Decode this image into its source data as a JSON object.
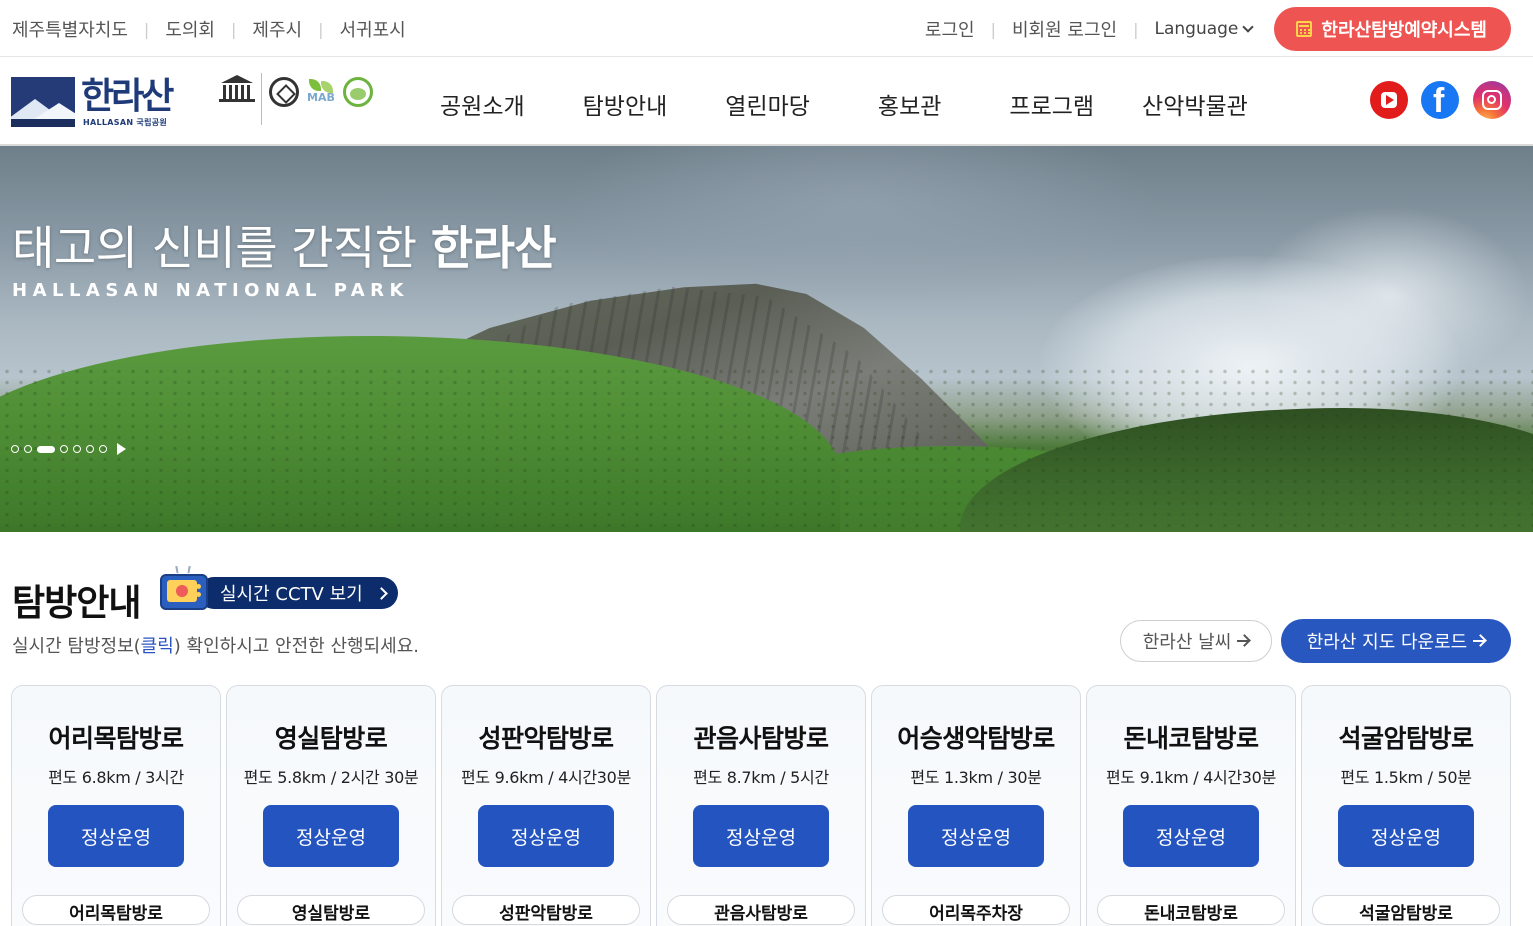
{
  "util": {
    "left_links": [
      "제주특별자치도",
      "도의회",
      "제주시",
      "서귀포시"
    ],
    "login": "로그인",
    "guest_login": "비회원 로그인",
    "language": "Language",
    "reserve": "한라산탐방예약시스템"
  },
  "logo": {
    "name": "한라산",
    "sub": "HALLASAN 국립공원"
  },
  "nav": [
    "공원소개",
    "탐방안내",
    "열린마당",
    "홍보관",
    "프로그램",
    "산악박물관"
  ],
  "social": [
    "youtube-icon",
    "facebook-icon",
    "instagram-icon"
  ],
  "hero": {
    "title_light": "태고의 신비를 간직한",
    "title_bold": "한라산",
    "subtitle": "HALLASAN NATIONAL PARK",
    "slide_count": 7,
    "active_slide": 3
  },
  "trail": {
    "title": "탐방안내",
    "cctv": "실시간 CCTV 보기",
    "desc_pre": "실시간 탐방정보(",
    "desc_link": "클릭",
    "desc_post": ") 확인하시고 안전한 산행되세요.",
    "weather": "한라산 날씨",
    "map_download": "한라산 지도 다운로드"
  },
  "cards": [
    {
      "name": "어리목탐방로",
      "dist": "편도 6.8km / 3시간",
      "status": "정상운영",
      "tag": "어리목탐방로"
    },
    {
      "name": "영실탐방로",
      "dist": "편도 5.8km / 2시간 30분",
      "status": "정상운영",
      "tag": "영실탐방로"
    },
    {
      "name": "성판악탐방로",
      "dist": "편도 9.6km / 4시간30분",
      "status": "정상운영",
      "tag": "성판악탐방로"
    },
    {
      "name": "관음사탐방로",
      "dist": "편도 8.7km / 5시간",
      "status": "정상운영",
      "tag": "관음사탐방로"
    },
    {
      "name": "어승생악탐방로",
      "dist": "편도 1.3km / 30분",
      "status": "정상운영",
      "tag": "어리목주차장"
    },
    {
      "name": "돈내코탐방로",
      "dist": "편도 9.1km / 4시간30분",
      "status": "정상운영",
      "tag": "돈내코탐방로"
    },
    {
      "name": "석굴암탐방로",
      "dist": "편도 1.5km / 50분",
      "status": "정상운영",
      "tag": "석굴암탐방로"
    }
  ],
  "colors": {
    "accent": "#2857c0",
    "reserve": "#ee5451",
    "navy": "#0c2c6b"
  }
}
